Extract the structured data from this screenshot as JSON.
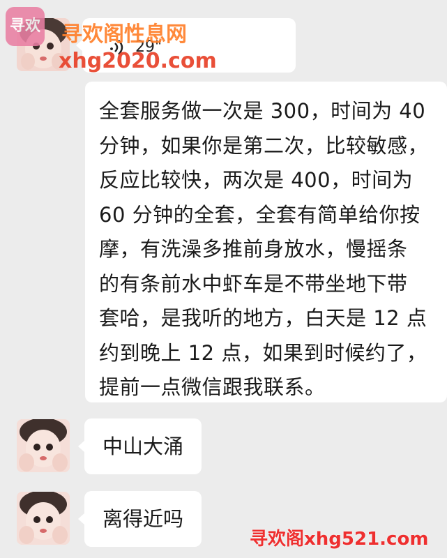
{
  "chat": {
    "voice_message": {
      "duration": "29\""
    },
    "text_message": {
      "lines": [
        "全套服务做一次是 300，时间为 40",
        "分钟，如果你是第二次，比较敏感，",
        "反应比较快，两次是 400，时间为",
        "60 分钟的全套，全套有简单给你按",
        "摩，有洗澡多推前身放水，慢摇条",
        "的有条前水中虾车是不带坐地下带",
        "套哈，是我听的地方，白天是 12 点",
        "约到晚上 12 点，如果到时候约了，",
        "提前一点微信跟我联系。"
      ]
    },
    "short_messages": [
      "中山大涌",
      "离得近吗"
    ]
  },
  "watermark": {
    "logo_text": "寻欢",
    "site_name": "寻欢阁性息网",
    "top_url": "xhg2020.com",
    "bottom_text": "寻欢阁xhg521.com"
  },
  "colors": {
    "background": "#ececec",
    "bubble": "#ffffff",
    "text": "#1a1a1a",
    "watermark_orange": "#ff7f2a",
    "watermark_red": "#e8462e",
    "watermark_pink": "#e97fa3"
  },
  "icons": [
    "avatar",
    "voice-wave-icon",
    "app-logo"
  ]
}
